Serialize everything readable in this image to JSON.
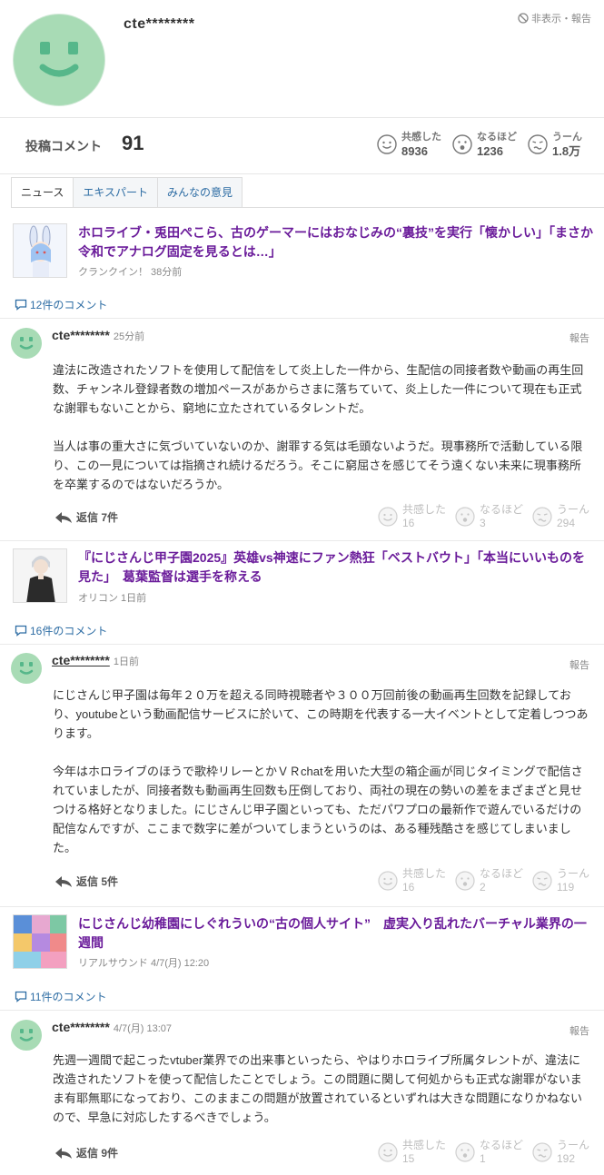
{
  "profile": {
    "username": "cte********",
    "hide_report": "非表示・報告"
  },
  "stats": {
    "label": "投稿コメント",
    "count": "91",
    "reactions": [
      {
        "label": "共感した",
        "value": "8936"
      },
      {
        "label": "なるほど",
        "value": "1236"
      },
      {
        "label": "うーん",
        "value": "1.8万"
      }
    ]
  },
  "tabs": [
    "ニュース",
    "エキスパート",
    "みんなの意見"
  ],
  "articles": [
    {
      "title": "ホロライブ・兎田ぺこら、古のゲーマーにはおなじみの“裏技”を実行「懐かしい」「まさか令和でアナログ固定を見るとは…」",
      "source": "クランクイン！ 38分前",
      "comments_link": "12件のコメント",
      "comment": {
        "user": "cte********",
        "time": "25分前",
        "report": "報告",
        "body": "違法に改造されたソフトを使用して配信をして炎上した一件から、生配信の同接者数や動画の再生回数、チャンネル登録者数の増加ペースがあからさまに落ちていて、炎上した一件について現在も正式な謝罪もないことから、窮地に立たされているタレントだ。\n\n当人は事の重大さに気づいていないのか、謝罪する気は毛頭ないようだ。現事務所で活動している限り、この一見については指摘され続けるだろう。そこに窮屈さを感じてそう遠くない未来に現事務所を卒業するのではないだろうか。",
        "reply": "返信 7件",
        "reactions": [
          {
            "label": "共感した",
            "value": "16"
          },
          {
            "label": "なるほど",
            "value": "3"
          },
          {
            "label": "うーん",
            "value": "294"
          }
        ]
      }
    },
    {
      "title": "『にじさんじ甲子園2025』英雄vs神速にファン熱狂「ベストバウト」「本当にいいものを見た」　葛葉監督は選手を称える",
      "source": "オリコン 1日前",
      "comments_link": "16件のコメント",
      "comment": {
        "user": "cte********",
        "time": "1日前",
        "report": "報告",
        "body": "にじさんじ甲子園は毎年２０万を超える同時視聴者や３００万回前後の動画再生回数を記録しており、youtubeという動画配信サービスに於いて、この時期を代表する一大イベントとして定着しつつあります。\n\n今年はホロライブのほうで歌枠リレーとかＶＲchatを用いた大型の箱企画が同じタイミングで配信されていましたが、同接者数も動画再生回数も圧倒しており、両社の現在の勢いの差をまざまざと見せつける格好となりました。にじさんじ甲子園といっても、ただパワプロの最新作で遊んでいるだけの配信なんですが、ここまで数字に差がついてしまうというのは、ある種残酷さを感じてしまいました。",
        "reply": "返信 5件",
        "reactions": [
          {
            "label": "共感した",
            "value": "16"
          },
          {
            "label": "なるほど",
            "value": "2"
          },
          {
            "label": "うーん",
            "value": "119"
          }
        ]
      }
    },
    {
      "title": "にじさんじ幼稚園にしぐれういの“古の個人サイト”　虚実入り乱れたバーチャル業界の一週間",
      "source": "リアルサウンド 4/7(月) 12:20",
      "comments_link": "11件のコメント",
      "comment": {
        "user": "cte********",
        "time": "4/7(月) 13:07",
        "report": "報告",
        "body": "先週一週間で起こったvtuber業界での出来事といったら、やはりホロライブ所属タレントが、違法に改造されたソフトを使って配信したことでしょう。この問題に関して何処からも正式な謝罪がないまま有耶無耶になっており、このままこの問題が放置されているといずれは大きな問題になりかねないので、早急に対応したするべきでしょう。",
        "reply": "返信 9件",
        "reactions": [
          {
            "label": "共感した",
            "value": "15"
          },
          {
            "label": "なるほど",
            "value": "1"
          },
          {
            "label": "うーん",
            "value": "192"
          }
        ]
      }
    }
  ],
  "icons": {
    "avatar": "smiley-avatar-icon",
    "empathy": "smile-face-icon",
    "naruhodo": "surprised-face-icon",
    "uun": "confused-face-icon",
    "comment": "speech-bubble-icon",
    "reply": "reply-arrow-icon",
    "hide": "block-icon"
  },
  "colors": {
    "avatar": "#a8dbb5",
    "avatar_face": "#56b78a",
    "article_title": "#6a1b9a",
    "link": "#2e6da4"
  }
}
